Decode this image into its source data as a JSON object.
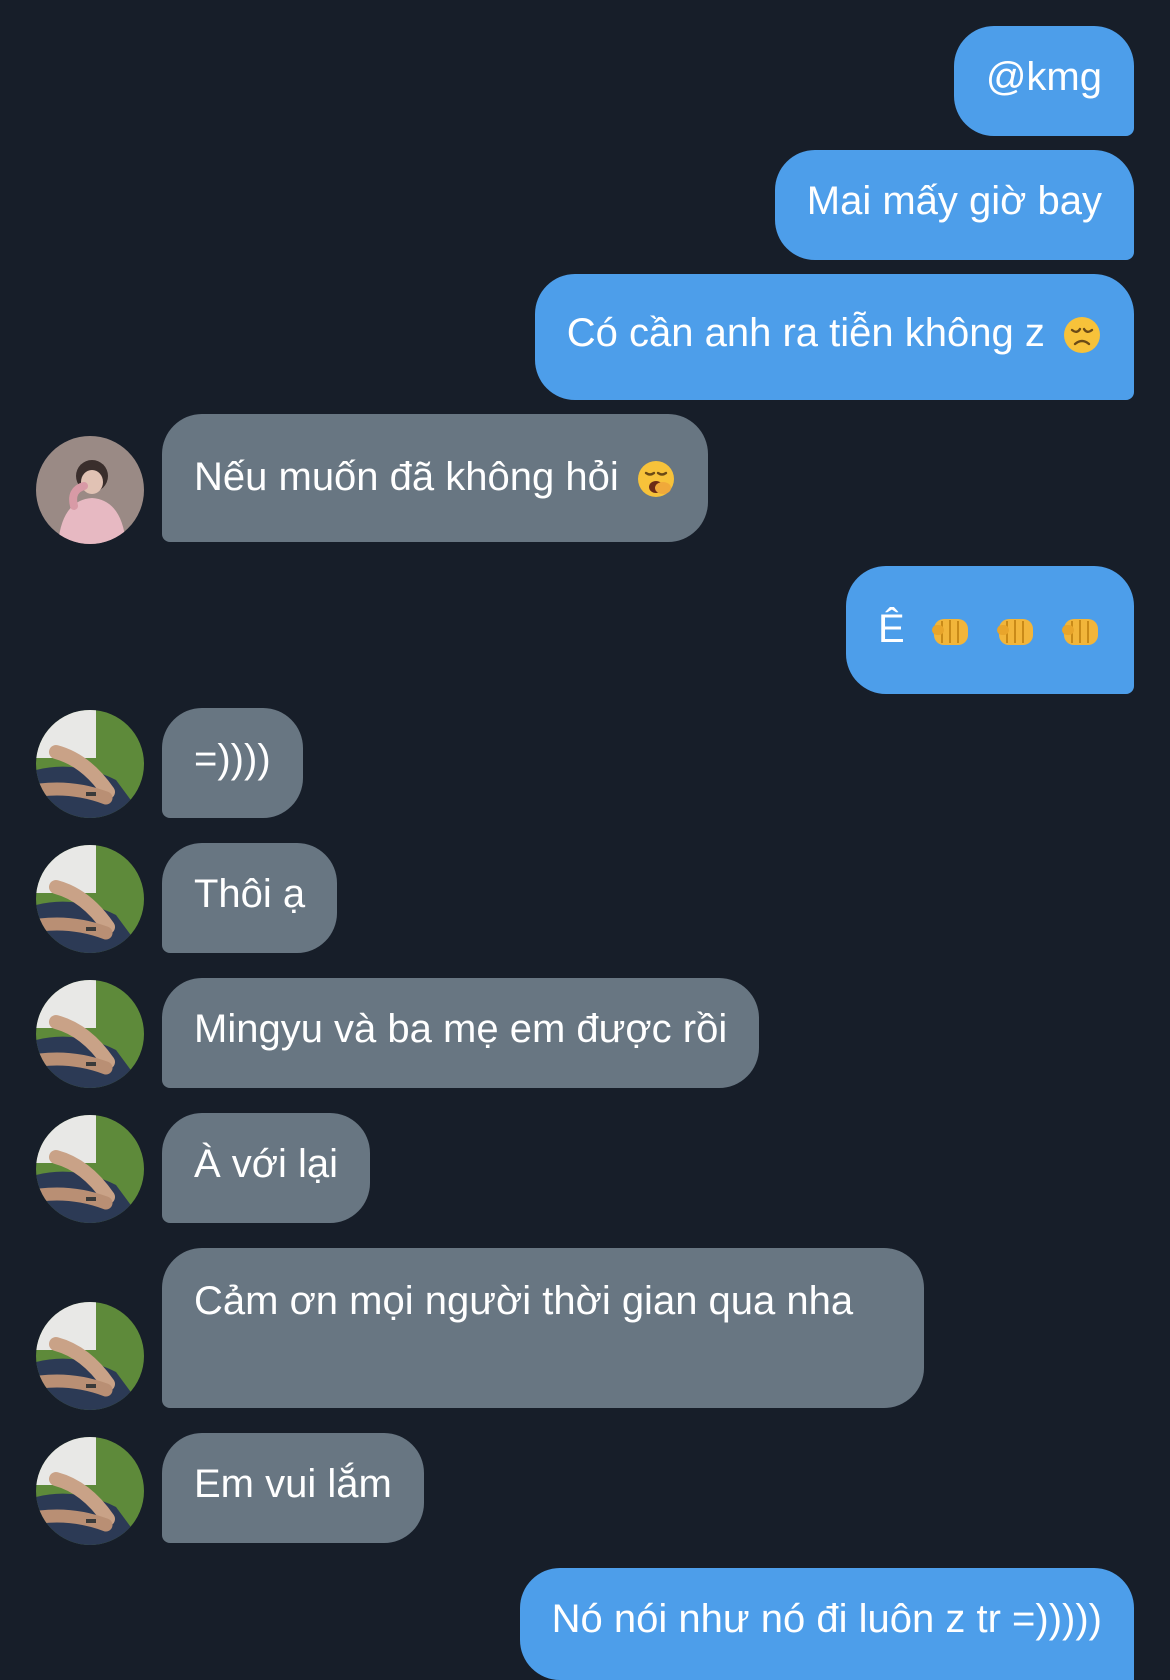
{
  "messages": [
    {
      "dir": "out",
      "text": "@kmg"
    },
    {
      "dir": "out",
      "text": "Mai mấy giờ bay"
    },
    {
      "dir": "out",
      "text": "Có cần anh ra tiễn không z",
      "emoji": [
        "disappointed-face"
      ]
    },
    {
      "dir": "in",
      "text": "Nếu muốn đã không hỏi",
      "emoji": [
        "yawning-face"
      ],
      "avatar": "avatar-pink-shirt"
    },
    {
      "dir": "out",
      "text": "Ê",
      "emoji": [
        "oncoming-fist",
        "oncoming-fist",
        "oncoming-fist"
      ]
    },
    {
      "dir": "in",
      "text": "=))))",
      "avatar": "avatar-arms-grass"
    },
    {
      "dir": "in",
      "text": "Thôi ạ",
      "avatar": "avatar-arms-grass"
    },
    {
      "dir": "in",
      "text": "Mingyu và ba mẹ em được rồi",
      "avatar": "avatar-arms-grass"
    },
    {
      "dir": "in",
      "text": "À với lại",
      "avatar": "avatar-arms-grass"
    },
    {
      "dir": "in",
      "text": "Cảm ơn mọi người thời gian qua nha",
      "avatar": "avatar-arms-grass"
    },
    {
      "dir": "in",
      "text": "Em vui lắm",
      "avatar": "avatar-arms-grass"
    },
    {
      "dir": "out",
      "text": "Nó nói như nó đi luôn z tr =)))))"
    }
  ],
  "colors": {
    "background": "#171e29",
    "outgoing_bubble": "#4d9eea",
    "incoming_bubble": "#687682",
    "text": "#ffffff"
  }
}
